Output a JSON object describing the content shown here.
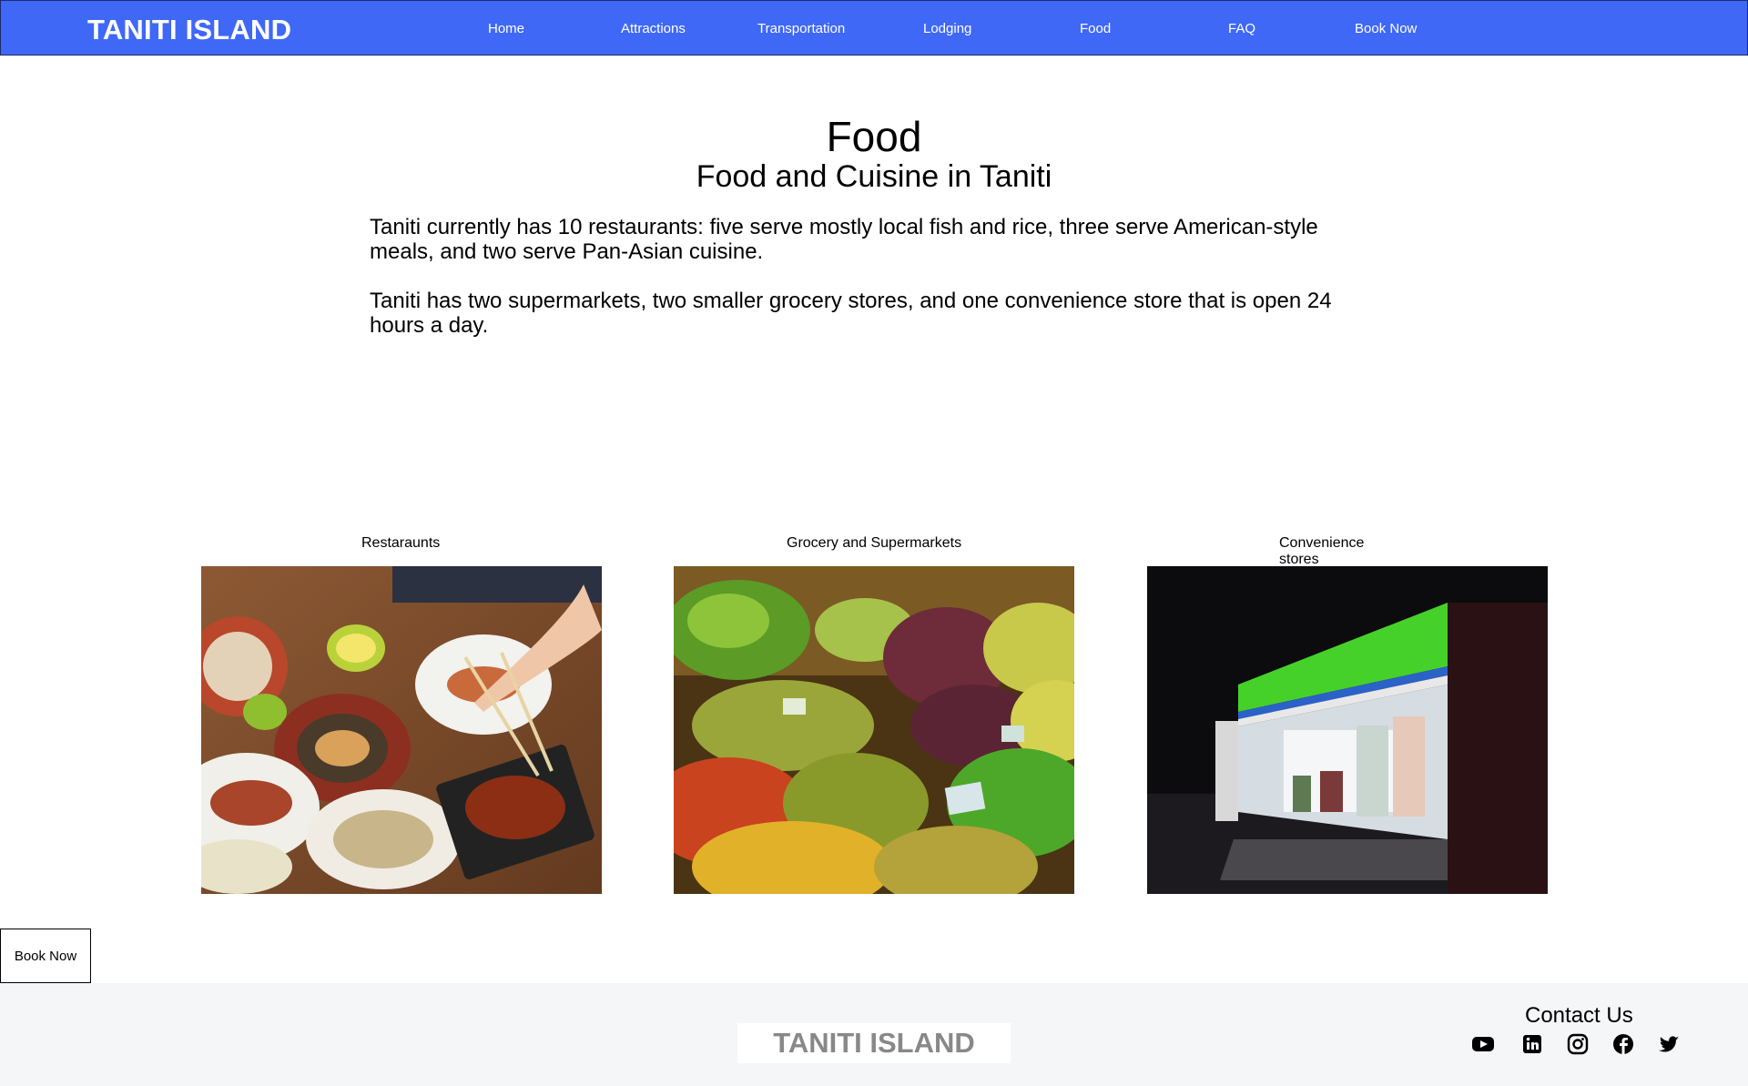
{
  "header": {
    "brand": "TANITI ISLAND",
    "nav": [
      {
        "label": "Home"
      },
      {
        "label": "Attractions"
      },
      {
        "label": "Transportation"
      },
      {
        "label": "Lodging"
      },
      {
        "label": "Food"
      },
      {
        "label": "FAQ"
      },
      {
        "label": "Book Now"
      }
    ],
    "bar_color": "#3f68f7"
  },
  "main": {
    "title": "Food",
    "subtitle": "Food and Cuisine in Taniti",
    "paragraphs": [
      "Taniti currently has 10 restaurants: five serve mostly local fish and rice, three serve American-style meals, and two serve Pan-Asian cuisine.",
      "Taniti has two supermarkets, two smaller grocery stores, and one convenience store that is open 24 hours a day."
    ],
    "cards": [
      {
        "label": "Restaraunts",
        "image": "restaurant-table-photo"
      },
      {
        "label": "Grocery and Supermarkets",
        "image": "fruit-market-photo"
      },
      {
        "label": "Convenience stores",
        "image": "convenience-store-photo"
      }
    ]
  },
  "book_button": {
    "label": "Book Now"
  },
  "footer": {
    "logo": "TANITI ISLAND",
    "contact_title": "Contact Us",
    "social": [
      "youtube-icon",
      "linkedin-icon",
      "instagram-icon",
      "facebook-icon",
      "twitter-icon"
    ]
  }
}
